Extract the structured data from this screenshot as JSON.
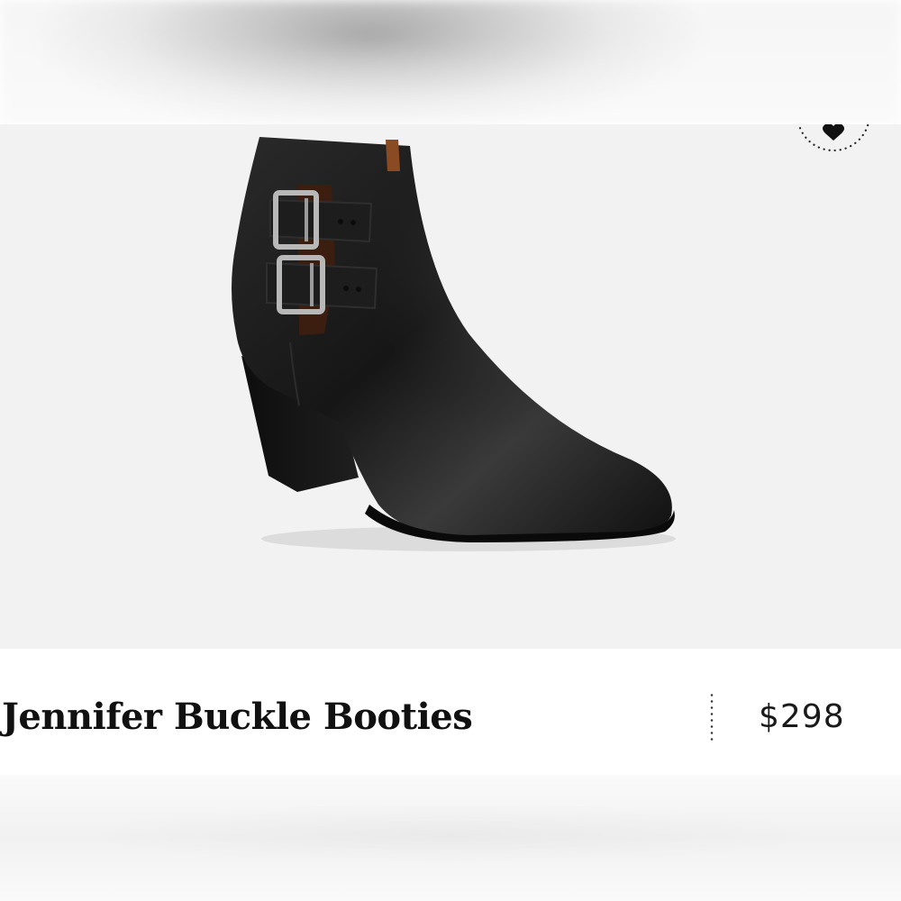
{
  "product": {
    "name": "Jennifer Buckle Booties",
    "price": "$298",
    "image_subject": "black-leather-buckle-ankle-bootie"
  },
  "icons": {
    "wishlist": "heart-icon"
  },
  "colors": {
    "background": "#ffffff",
    "image_background": "#f2f2f2",
    "text": "#111111",
    "boot_leather": "#1b1b1b",
    "buckle_metal": "#b8b8b8"
  }
}
